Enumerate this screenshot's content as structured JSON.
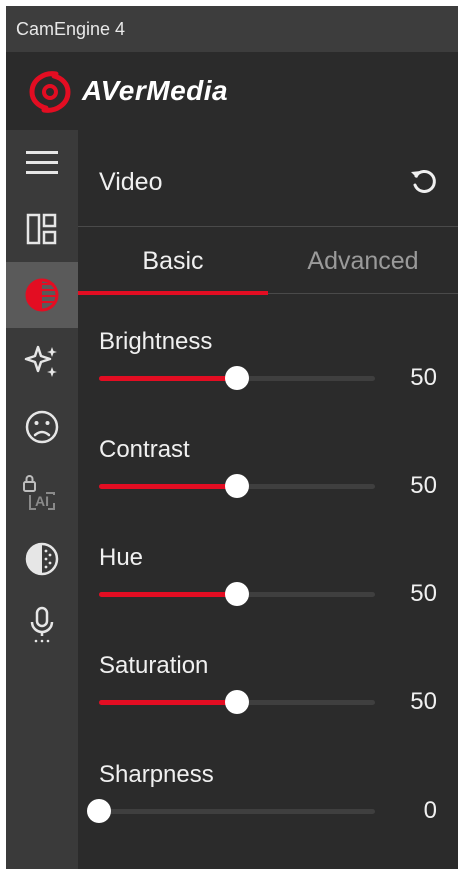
{
  "app": {
    "title": "CamEngine 4",
    "brand": "AVerMedia"
  },
  "colors": {
    "accent": "#e30d22",
    "background": "#2b2b2b",
    "sidebar": "#3a3a3a"
  },
  "sidebar": {
    "items": [
      {
        "icon": "menu-icon",
        "active": false
      },
      {
        "icon": "layout-icon",
        "active": false
      },
      {
        "icon": "video-adjust-icon",
        "active": true
      },
      {
        "icon": "sparkle-effects-icon",
        "active": false
      },
      {
        "icon": "face-icon",
        "active": false
      },
      {
        "icon": "ai-locked-icon",
        "active": false
      },
      {
        "icon": "background-icon",
        "active": false
      },
      {
        "icon": "microphone-icon",
        "active": false
      }
    ]
  },
  "panel": {
    "title": "Video",
    "reset_icon": "reset-icon",
    "tabs": [
      {
        "label": "Basic",
        "active": true
      },
      {
        "label": "Advanced",
        "active": false
      }
    ],
    "sliders": [
      {
        "label": "Brightness",
        "value": "50",
        "level": 0.5
      },
      {
        "label": "Contrast",
        "value": "50",
        "level": 0.5
      },
      {
        "label": "Hue",
        "value": "50",
        "level": 0.5
      },
      {
        "label": "Saturation",
        "value": "50",
        "level": 0.5
      },
      {
        "label": "Sharpness",
        "value": "0",
        "level": 0.0
      }
    ]
  }
}
